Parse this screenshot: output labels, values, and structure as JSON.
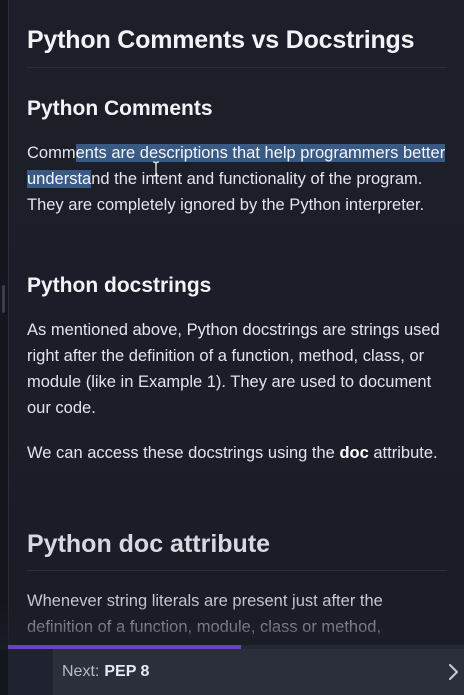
{
  "article": {
    "title": "Python Comments vs Docstrings",
    "section_comments": {
      "heading": "Python Comments",
      "text_before": "Comm",
      "text_highlighted": "ents are descriptions that help programmers better understa",
      "text_after": "nd the intent and functionality of the program. They are completely ignored by the Python interpreter."
    },
    "section_docstrings": {
      "heading": "Python docstrings",
      "paragraph1": "As mentioned above, Python docstrings are strings used right after the definition of a function, method, class, or module (like in Example 1). They are used to document our code.",
      "paragraph2_before": "We can access these docstrings using the ",
      "paragraph2_bold": "doc",
      "paragraph2_after": " attribute."
    },
    "section_doc_attribute": {
      "heading": "Python doc attribute",
      "paragraph": "Whenever string literals are present just after the definition of a function, module, class or method,"
    }
  },
  "footer": {
    "next_prefix": "Next:",
    "next_title": "PEP 8",
    "chevron_icon": "chevron-right-icon",
    "progress_fraction": 0.51,
    "progress_color": "#6a42c8"
  },
  "cursor_icon": "text-cursor-icon",
  "colors": {
    "background": "#1b1d27",
    "highlight": "#3a5a86"
  }
}
